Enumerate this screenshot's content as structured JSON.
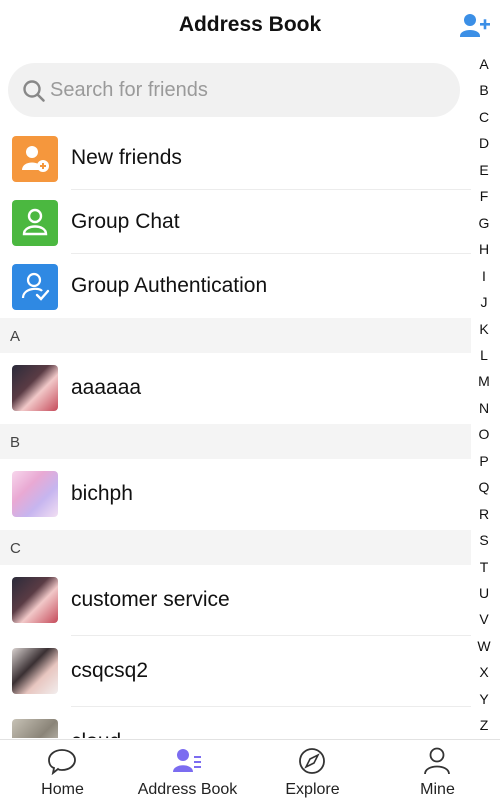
{
  "header": {
    "title": "Address Book",
    "add_icon": "add-friend-icon",
    "accent": "#3b8fe6"
  },
  "search": {
    "placeholder": "Search for friends",
    "icon": "search-icon"
  },
  "features": [
    {
      "label": "New friends",
      "icon": "new-friends-icon",
      "color": "#f5973d"
    },
    {
      "label": "Group Chat",
      "icon": "group-chat-icon",
      "color": "#4bb840"
    },
    {
      "label": "Group Authentication",
      "icon": "group-authentication-icon",
      "color": "#2f89e3"
    }
  ],
  "sections": [
    {
      "letter": "A",
      "contacts": [
        {
          "name": "aaaaaa"
        }
      ]
    },
    {
      "letter": "B",
      "contacts": [
        {
          "name": "bichph"
        }
      ]
    },
    {
      "letter": "C",
      "contacts": [
        {
          "name": "customer service"
        },
        {
          "name": "csqcsq2"
        },
        {
          "name": "cloud..."
        }
      ]
    }
  ],
  "index_letters": [
    "A",
    "B",
    "C",
    "D",
    "E",
    "F",
    "G",
    "H",
    "I",
    "J",
    "K",
    "L",
    "M",
    "N",
    "O",
    "P",
    "Q",
    "R",
    "S",
    "T",
    "U",
    "V",
    "W",
    "X",
    "Y",
    "Z"
  ],
  "tabs": [
    {
      "label": "Home",
      "icon": "chat-bubble-icon",
      "active": false
    },
    {
      "label": "Address Book",
      "icon": "contacts-icon",
      "active": true
    },
    {
      "label": "Explore",
      "icon": "compass-icon",
      "active": false
    },
    {
      "label": "Mine",
      "icon": "person-icon",
      "active": false
    }
  ],
  "active_color": "#7b6cf0"
}
